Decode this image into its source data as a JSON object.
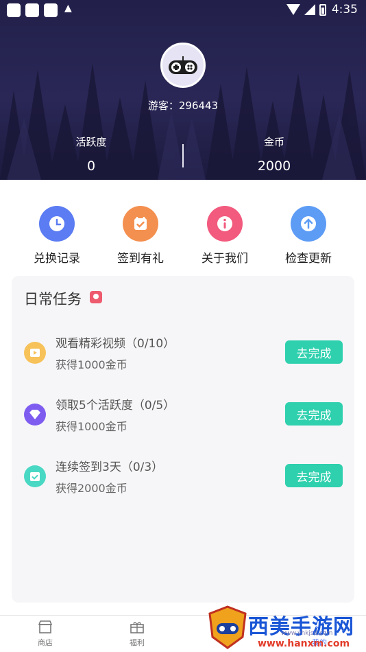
{
  "status_bar": {
    "time": "4:35"
  },
  "profile": {
    "guest_label": "游客：296443"
  },
  "stats": {
    "activity_label": "活跃度",
    "activity_value": "0",
    "coins_label": "金币",
    "coins_value": "2000"
  },
  "actions": [
    {
      "label": "兑换记录",
      "icon": "clock-icon",
      "color": "#5b7cf2"
    },
    {
      "label": "签到有礼",
      "icon": "calendar-check-icon",
      "color": "#f4904f"
    },
    {
      "label": "关于我们",
      "icon": "info-icon",
      "color": "#f25a7e"
    },
    {
      "label": "检查更新",
      "icon": "upload-arrow-icon",
      "color": "#5d9cf5"
    }
  ],
  "daily_tasks": {
    "title": "日常任务",
    "items": [
      {
        "title": "观看精彩视频（0/10）",
        "reward": "获得1000金币",
        "button": "去完成",
        "icon": "play-icon",
        "color": "#f7c25a"
      },
      {
        "title": "领取5个活跃度（0/5）",
        "reward": "获得1000金币",
        "button": "去完成",
        "icon": "diamond-icon",
        "color": "#7e5cf0"
      },
      {
        "title": "连续签到3天（0/3）",
        "reward": "获得2000金币",
        "button": "去完成",
        "icon": "check-calendar-icon",
        "color": "#49d8c4"
      }
    ]
  },
  "bottom_nav": {
    "shop": "商店",
    "welfare": "福利",
    "mine": "我的"
  },
  "watermark": {
    "title": "西美手游网",
    "sub": "www.yhkjsd.com",
    "url": "www.hanxm.com"
  }
}
